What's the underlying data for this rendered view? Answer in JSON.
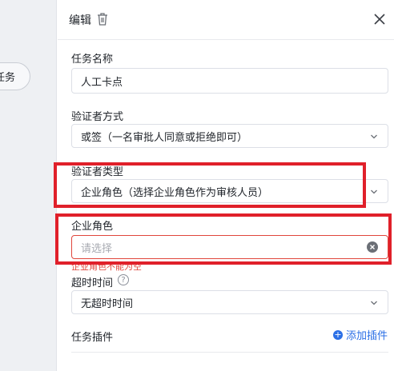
{
  "canvas": {
    "node_label": "任务"
  },
  "header": {
    "title": "编辑",
    "delete_icon": "trash-icon",
    "close_icon": "close-icon"
  },
  "form": {
    "task_name": {
      "label": "任务名称",
      "value": "人工卡点"
    },
    "verifier_method": {
      "label": "验证者方式",
      "value": "或签（一名审批人同意或拒绝即可）"
    },
    "verifier_type": {
      "label": "验证者类型",
      "value": "企业角色（选择企业角色作为审核人员）"
    },
    "enterprise_role": {
      "label": "企业角色",
      "placeholder": "请选择",
      "error": "企业角色不能为空"
    },
    "timeout": {
      "label": "超时时间",
      "value": "无超时时间",
      "help": "?"
    },
    "plugins": {
      "label": "任务插件",
      "add_label": "添加插件"
    }
  },
  "colors": {
    "accent": "#2b6fe6",
    "error": "#e0463c",
    "annotation": "#e0202a"
  }
}
